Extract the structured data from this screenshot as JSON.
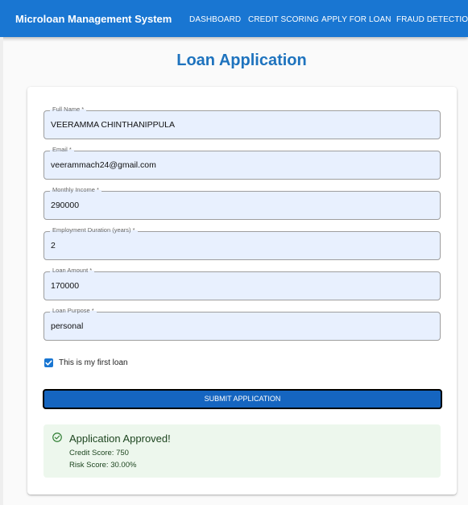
{
  "app": {
    "title": "Microloan Management System",
    "nav": [
      "DASHBOARD",
      "CREDIT SCORING",
      "APPLY FOR LOAN",
      "FRAUD DETECTION"
    ]
  },
  "page": {
    "title": "Loan Application"
  },
  "form": {
    "fields": [
      {
        "label": "Full Name *",
        "value": "VEERAMMA CHINTHANIPPULA"
      },
      {
        "label": "Email *",
        "value": "veerammach24@gmail.com"
      },
      {
        "label": "Monthly Income *",
        "value": "290000"
      },
      {
        "label": "Employment Duration (years) *",
        "value": "2"
      },
      {
        "label": "Loan Amount *",
        "value": "170000"
      },
      {
        "label": "Loan Purpose *",
        "value": "personal"
      }
    ],
    "first_loan": {
      "label": "This is my first loan",
      "checked": true
    },
    "submit_label": "SUBMIT APPLICATION"
  },
  "result": {
    "title": "Application Approved!",
    "credit_score": "Credit Score: 750",
    "risk_score": "Risk Score: 30.00%",
    "icon": "check-circle-icon"
  },
  "colors": {
    "primary": "#1976d2",
    "title_blue": "#1e73be",
    "input_fill": "#e8f0fe",
    "success_bg": "#edf7ed",
    "success_text": "#1e4620",
    "success_icon": "#2e7d32"
  }
}
